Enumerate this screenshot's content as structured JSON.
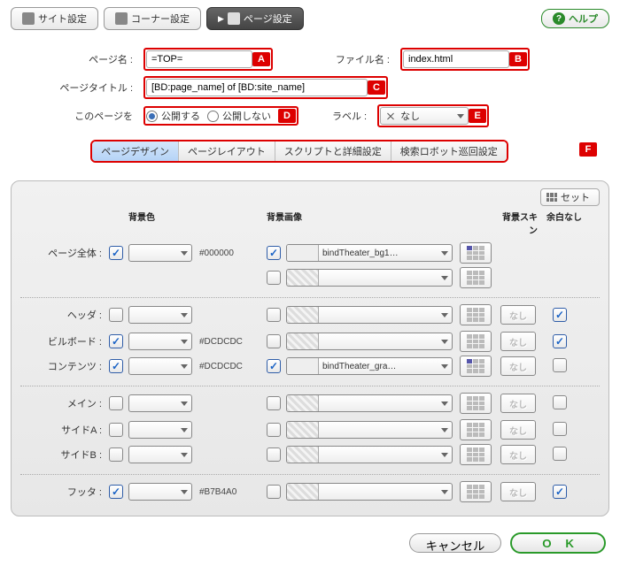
{
  "toolbar": {
    "site": "サイト設定",
    "corner": "コーナー設定",
    "page": "ページ設定",
    "help": "ヘルプ"
  },
  "form": {
    "page_name_label": "ページ名 :",
    "page_name_value": "=TOP=",
    "file_name_label": "ファイル名 :",
    "file_name_value": "index.html",
    "page_title_label": "ページタイトル :",
    "page_title_value": "[BD:page_name] of [BD:site_name]",
    "this_page_label": "このページを",
    "radio_publish": "公開する",
    "radio_unpublish": "公開しない",
    "label_label": "ラベル :",
    "label_value": "なし"
  },
  "tabs": {
    "t1": "ページデザイン",
    "t2": "ページレイアウト",
    "t3": "スクリプトと詳細設定",
    "t4": "検索ロボット巡回設定"
  },
  "markers": {
    "a": "A",
    "b": "B",
    "c": "C",
    "d": "D",
    "e": "E",
    "f": "F"
  },
  "panel": {
    "set_label": "セット",
    "headers": {
      "bgcolor": "背景色",
      "bgimage": "背景画像",
      "bgskin": "背景スキン",
      "nomargin": "余白なし"
    },
    "rows": {
      "page": {
        "label": "ページ全体 :",
        "colorText": "#000000",
        "imgName": "bindTheater_bg1…"
      },
      "header": {
        "label": "ヘッダ :",
        "skin": "なし"
      },
      "billboard": {
        "label": "ビルボード :",
        "colorText": "#DCDCDC",
        "skin": "なし"
      },
      "contents": {
        "label": "コンテンツ :",
        "colorText": "#DCDCDC",
        "imgName": "bindTheater_gra…",
        "skin": "なし"
      },
      "main": {
        "label": "メイン :",
        "skin": "なし"
      },
      "sideA": {
        "label": "サイドA :",
        "skin": "なし"
      },
      "sideB": {
        "label": "サイドB :",
        "skin": "なし"
      },
      "footer": {
        "label": "フッタ :",
        "colorText": "#B7B4A0",
        "skin": "なし"
      }
    }
  },
  "buttons": {
    "cancel": "キャンセル",
    "ok": "O K"
  }
}
